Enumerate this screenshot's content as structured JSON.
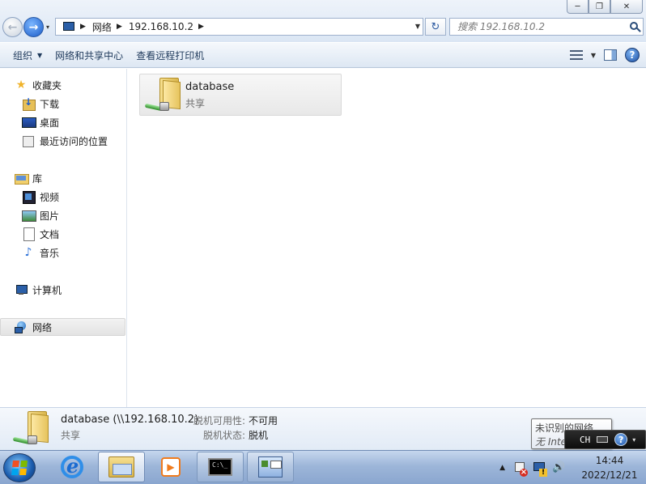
{
  "window": {
    "controls": {
      "minimize": "─",
      "maximize": "❐",
      "close": "✕"
    }
  },
  "nav": {
    "back_glyph": "←",
    "forward_glyph": "→",
    "recent_glyph": "▾"
  },
  "address": {
    "crumbs": [
      "网络",
      "192.168.10.2"
    ],
    "separator": "▶",
    "dropdown_glyph": "▼",
    "refresh_glyph": "↻"
  },
  "search": {
    "placeholder": "搜索 192.168.10.2"
  },
  "toolbar": {
    "organize": "组织",
    "organize_caret": "▼",
    "network_center": "网络和共享中心",
    "remote_printers": "查看远程打印机",
    "view_caret": "▼",
    "help_glyph": "?"
  },
  "sidebar": {
    "favorites": "收藏夹",
    "downloads": "下载",
    "desktop": "桌面",
    "recent": "最近访问的位置",
    "libraries": "库",
    "videos": "视频",
    "pictures": "图片",
    "documents": "文档",
    "music": "音乐",
    "computer": "计算机",
    "network": "网络",
    "star_glyph": "★",
    "music_glyph": "♪"
  },
  "content": {
    "items": [
      {
        "name": "database",
        "type": "共享"
      }
    ]
  },
  "details": {
    "name": "database (\\\\192.168.10.2)",
    "type": "共享",
    "availability_label": "脱机可用性:",
    "availability_value": "不可用",
    "status_label": "脱机状态:",
    "status_value": "脱机"
  },
  "taskbar": {
    "media_glyph": "▶",
    "cmd_text": "C:\\_",
    "tray_arrow": "▲",
    "volume_glyph": "🔊",
    "time": "14:44",
    "date": "2022/12/21"
  },
  "tooltip": {
    "line1": "未识别的网络",
    "line2": "无 Internet 访问"
  },
  "langbar": {
    "lang": "CH",
    "help_glyph": "?",
    "options_glyph": "▾"
  },
  "colors": {
    "accent": "#1e395b",
    "start_flag": [
      "#f25022",
      "#7fba00",
      "#00a4ef",
      "#ffb900"
    ]
  }
}
